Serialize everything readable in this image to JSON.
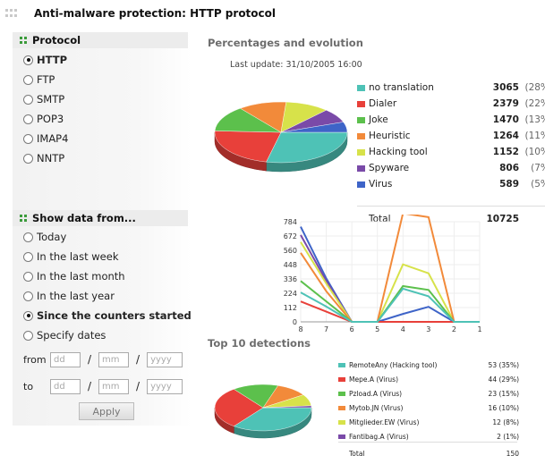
{
  "window": {
    "title": "Anti-malware protection: HTTP protocol"
  },
  "protocol": {
    "heading": "Protocol",
    "options": [
      "HTTP",
      "FTP",
      "SMTP",
      "POP3",
      "IMAP4",
      "NNTP"
    ],
    "selected": "HTTP"
  },
  "show_data": {
    "heading": "Show data from...",
    "options": [
      "Today",
      "In the last week",
      "In the last month",
      "In the last year",
      "Since the counters started",
      "Specify dates"
    ],
    "selected": "Since the counters started"
  },
  "dates": {
    "from_label": "from",
    "to_label": "to",
    "separator": "/",
    "dd_placeholder": "dd",
    "mm_placeholder": "mm",
    "yyyy_placeholder": "yyyy",
    "apply_label": "Apply"
  },
  "main": {
    "percentages_heading": "Percentages and evolution",
    "last_update": "Last update: 31/10/2005 16:00",
    "top10_heading": "Top 10 detections"
  },
  "summary": {
    "rows": [
      {
        "name": "no translation",
        "value": "3065",
        "pct": "(28%)",
        "color": "#4ec2b6"
      },
      {
        "name": "Dialer",
        "value": "2379",
        "pct": "(22%)",
        "color": "#e8403a"
      },
      {
        "name": "Joke",
        "value": "1470",
        "pct": "(13%)",
        "color": "#5cc04c"
      },
      {
        "name": "Heuristic",
        "value": "1264",
        "pct": "(11%)",
        "color": "#f28a3a"
      },
      {
        "name": "Hacking tool",
        "value": "1152",
        "pct": "(10%)",
        "color": "#d7e24a"
      },
      {
        "name": "Spyware",
        "value": "806",
        "pct": "(7%)",
        "color": "#7a4aa8"
      },
      {
        "name": "Virus",
        "value": "589",
        "pct": "(5%)",
        "color": "#3e64c8"
      }
    ],
    "total_label": "Total",
    "total_value": "10725"
  },
  "chart_data": [
    {
      "type": "pie",
      "labels": [
        "no translation",
        "Dialer",
        "Joke",
        "Heuristic",
        "Hacking tool",
        "Spyware",
        "Virus"
      ],
      "values": [
        3065,
        2379,
        1470,
        1264,
        1152,
        806,
        589
      ],
      "colors": [
        "#4ec2b6",
        "#e8403a",
        "#5cc04c",
        "#f28a3a",
        "#d7e24a",
        "#7a4aa8",
        "#3e64c8"
      ]
    },
    {
      "type": "line",
      "x": [
        8,
        7,
        6,
        5,
        4,
        3,
        2,
        1
      ],
      "yticks": [
        0,
        112,
        224,
        336,
        448,
        560,
        672,
        784
      ],
      "ylim": [
        0,
        784
      ],
      "series": [
        {
          "color": "#3e64c8",
          "values": [
            745,
            340,
            0,
            0,
            62,
            118,
            0,
            0
          ]
        },
        {
          "color": "#7a4aa8",
          "values": [
            680,
            320,
            0,
            0,
            0,
            0,
            0,
            0
          ]
        },
        {
          "color": "#d7e24a",
          "values": [
            625,
            300,
            0,
            0,
            450,
            380,
            0,
            0
          ]
        },
        {
          "color": "#f28a3a",
          "values": [
            540,
            240,
            0,
            0,
            850,
            820,
            0,
            0
          ]
        },
        {
          "color": "#5cc04c",
          "values": [
            320,
            160,
            0,
            0,
            280,
            250,
            0,
            0
          ]
        },
        {
          "color": "#e8403a",
          "values": [
            160,
            80,
            0,
            0,
            0,
            0,
            0,
            0
          ]
        },
        {
          "color": "#4ec2b6",
          "values": [
            230,
            120,
            0,
            0,
            260,
            200,
            0,
            0
          ]
        }
      ]
    },
    {
      "type": "pie",
      "labels": [
        "RemoteAny (Hacking tool)",
        "Mepe.A (Virus)",
        "Pzload.A (Virus)",
        "Mytob.JN (Virus)",
        "Mitglieder.EW (Virus)",
        "Fantibag.A (Virus)"
      ],
      "values": [
        53,
        44,
        23,
        16,
        12,
        2
      ],
      "colors": [
        "#4ec2b6",
        "#e8403a",
        "#5cc04c",
        "#f28a3a",
        "#d7e24a",
        "#7a4aa8"
      ]
    }
  ],
  "top10": {
    "rows": [
      {
        "name": "RemoteAny (Hacking tool)",
        "value": "53 (35%)",
        "color": "#4ec2b6"
      },
      {
        "name": "Mepe.A (Virus)",
        "value": "44 (29%)",
        "color": "#e8403a"
      },
      {
        "name": "Pzload.A (Virus)",
        "value": "23 (15%)",
        "color": "#5cc04c"
      },
      {
        "name": "Mytob.JN (Virus)",
        "value": "16 (10%)",
        "color": "#f28a3a"
      },
      {
        "name": "Mitglieder.EW (Virus)",
        "value": "12 (8%)",
        "color": "#d7e24a"
      },
      {
        "name": "Fantibag.A (Virus)",
        "value": "2 (1%)",
        "color": "#7a4aa8"
      }
    ],
    "total_label": "Total",
    "total_value": "150"
  }
}
